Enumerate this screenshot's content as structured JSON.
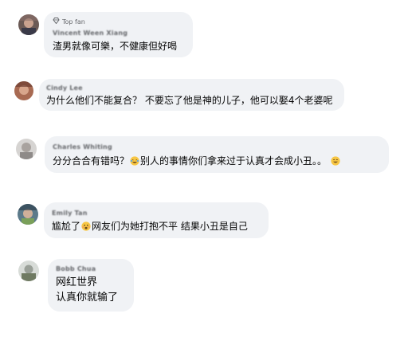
{
  "comments": [
    {
      "badge": "Top fan",
      "badge_icon": "diamond-icon",
      "author": "Vincent Ween Xiang",
      "text": "渣男就像可樂，不健康但好喝"
    },
    {
      "author": "Cindy Lee",
      "text": "为什么他们不能复合？ 不要忘了他是神的儿子，他可以娶4个老婆呢"
    },
    {
      "author": "Charles Whiting",
      "text_a": "分分合合有错吗？",
      "emoji_a": "laughing-tears-emoji",
      "text_b": "别人的事情你们拿来过于认真才会成小丑。。",
      "emoji_b": "grinning-emoji"
    },
    {
      "author": "Emily Tan",
      "text_a": "尴尬了",
      "emoji_a": "open-mouth-emoji",
      "text_b": "网友们为她打抱不平 结果小丑是自己"
    },
    {
      "author": "Bobb Chua",
      "line1": "网红世界",
      "line2": "认真你就输了"
    }
  ],
  "colors": {
    "bubble": "#f0f2f5",
    "text": "#050505",
    "meta": "#65676b",
    "emoji_face": "#f7c644"
  }
}
